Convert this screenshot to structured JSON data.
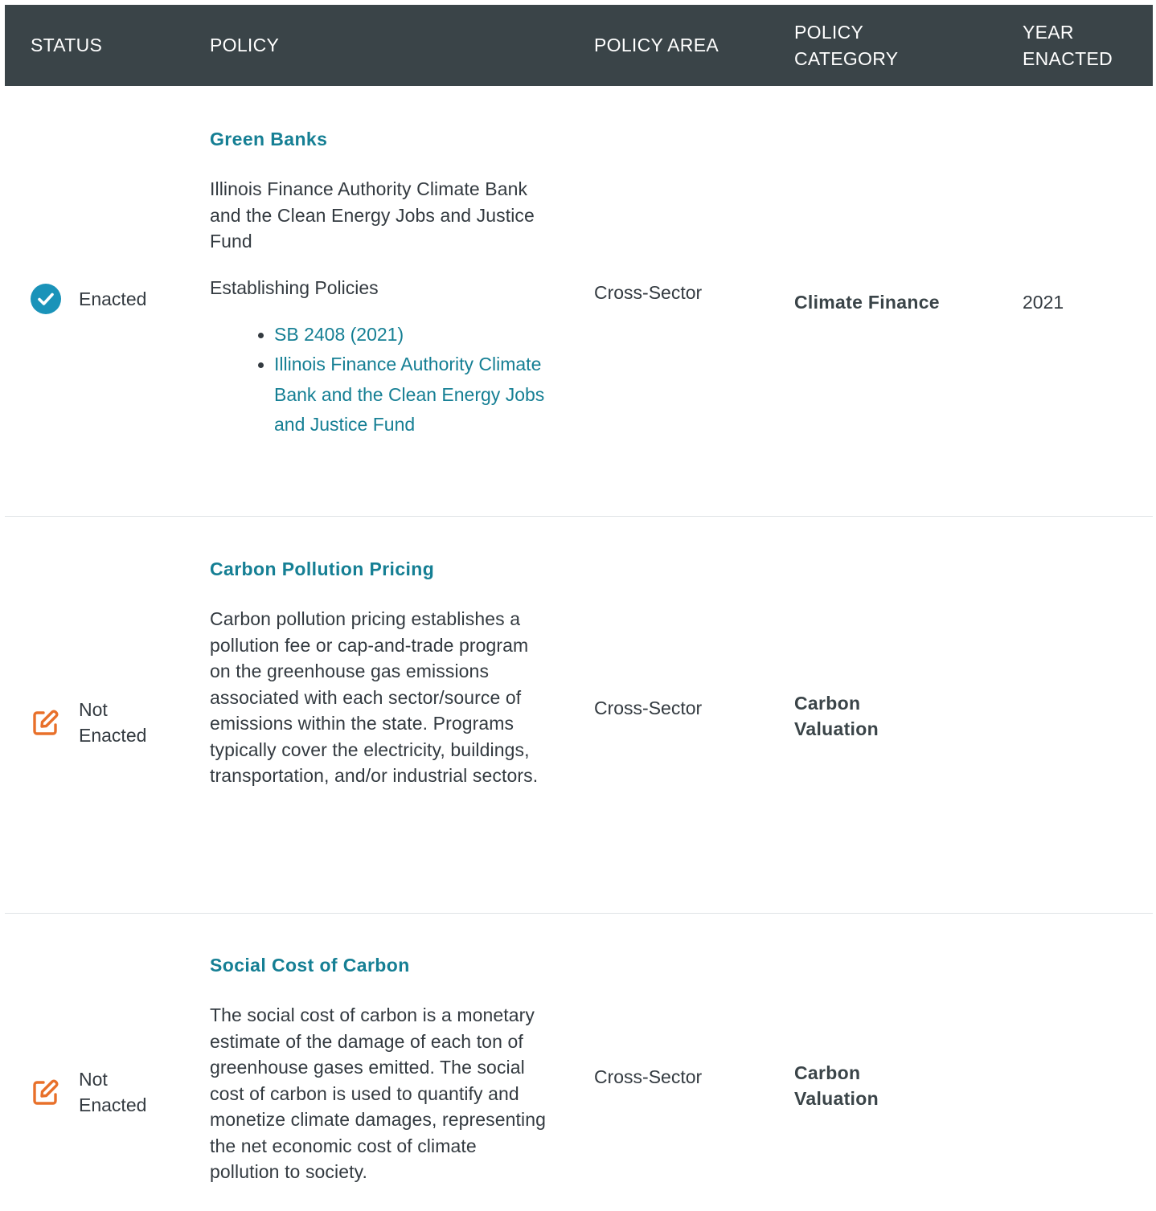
{
  "header": {
    "status": "STATUS",
    "policy": "POLICY",
    "policy_area": "POLICY AREA",
    "policy_category": "POLICY CATEGORY",
    "year_enacted": "YEAR ENACTED"
  },
  "colors": {
    "header_bg": "#3a4448",
    "link": "#157f94",
    "enacted_icon": "#1a93b9",
    "not_enacted_icon": "#e8702a"
  },
  "rows": [
    {
      "status": "Enacted",
      "status_icon": "check-circle-icon",
      "title": "Green Banks",
      "description": "Illinois Finance Authority Climate Bank and the Clean Energy Jobs and Justice Fund",
      "sub_heading": "Establishing Policies",
      "links": [
        "SB 2408 (2021)",
        "Illinois Finance Authority Climate Bank and the Clean Energy Jobs and Justice Fund"
      ],
      "policy_area": "Cross-Sector",
      "policy_category": "Climate Finance",
      "year": "2021"
    },
    {
      "status": "Not Enacted",
      "status_icon": "edit-icon",
      "title": "Carbon Pollution Pricing",
      "description": "Carbon pollution pricing establishes a pollution fee or cap-and-trade program on the greenhouse gas emissions associated with each sector/source of emissions within the state. Programs typically cover the electricity, buildings, transportation, and/or industrial sectors.",
      "policy_area": "Cross-Sector",
      "policy_category": "Carbon Valuation",
      "year": ""
    },
    {
      "status": "Not Enacted",
      "status_icon": "edit-icon",
      "title": "Social Cost of Carbon",
      "description": "The social cost of carbon is a monetary estimate of the damage of each ton of greenhouse gases emitted. The social cost of carbon is used to quantify and monetize climate damages, representing the net economic cost of climate pollution to society.",
      "policy_area": "Cross-Sector",
      "policy_category": "Carbon Valuation",
      "year": ""
    }
  ]
}
